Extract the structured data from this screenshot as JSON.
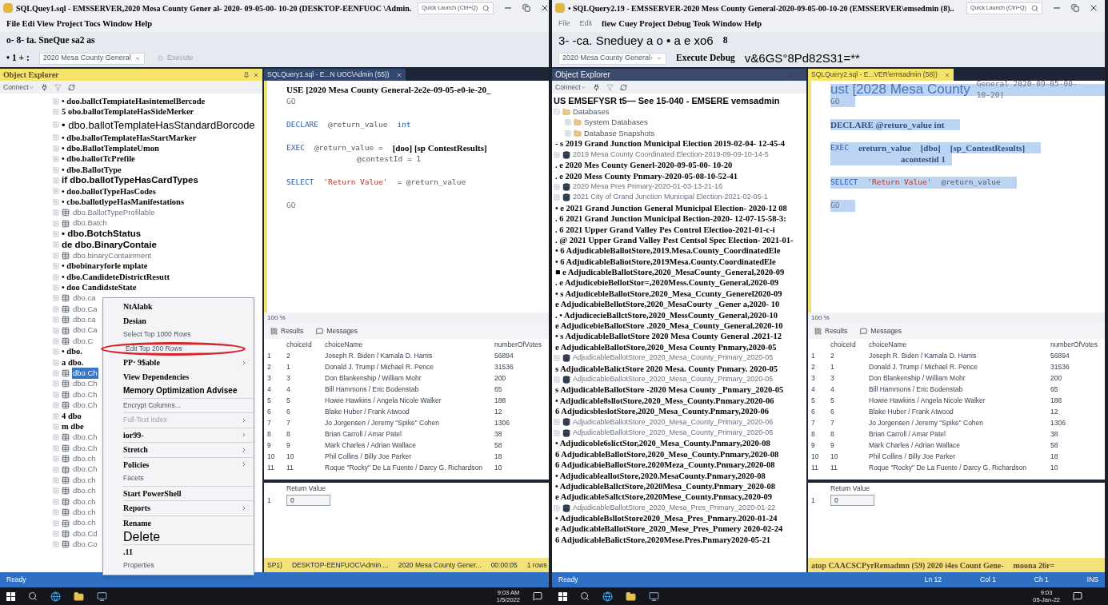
{
  "windows": [
    {
      "title": "SQLQuey1.sql - EMSSERVER,2020 Mesa County Gener al- 2020- 09-05-00- 10-20 (DESKTOP-EENFUOC \\Admin.",
      "quick_launch": {
        "placeholder": "Quick Launch (Ctrl+Q)"
      },
      "menu": [
        "File Edi View Project Tocs Window Help"
      ],
      "toolbar_1": [
        {
          "text": "o- 8- ta. SneQue sa2 as",
          "kind": "ocr"
        }
      ],
      "toolbar_2": [
        {
          "text": "• 1 + :",
          "kind": "ocr"
        },
        {
          "text": "2020 Mesa County General",
          "kind": "dropdown"
        },
        {
          "text": "Execute",
          "kind": "faint"
        }
      ],
      "explorer": {
        "title": "Object Explorer",
        "selected": true,
        "connect": "Connect",
        "items": [
          {
            "kind": "ocr",
            "text": "• doo.ballctTempiateHasintemelBercode",
            "selected": false
          },
          {
            "kind": "ocr",
            "text": "5 obo.ballotTemplateHasSideMerker",
            "selected": false
          },
          {
            "kind": "large",
            "text": "• dbo.ballotTemplateHasStandardBorcode",
            "selected": false
          },
          {
            "kind": "ocr",
            "text": "• dbo.ballotTemplateHasStartMarker",
            "selected": false
          },
          {
            "kind": "ocr",
            "text": "• dbo.BallotTemplateUmon",
            "selected": false
          },
          {
            "kind": "ocr",
            "text": "• dbo.ballotTcPrefile",
            "selected": false
          },
          {
            "kind": "ocr",
            "text": "• dbo.BallotType",
            "selected": false
          },
          {
            "kind": "sans",
            "text": "if dbo.ballotTypeHasCardTypes",
            "selected": false
          },
          {
            "kind": "ocr",
            "text": "• doo.ballotTypeHasCodes",
            "selected": false
          },
          {
            "kind": "ocr",
            "text": "• cbo.ballotlypeHasManifestations",
            "selected": false
          },
          {
            "kind": "table",
            "text": "dbo.BallotTypeProfilable",
            "selected": false
          },
          {
            "kind": "table",
            "text": "dbo.Batch",
            "selected": false
          },
          {
            "kind": "sans",
            "text": "• dbo.BotchStatus",
            "selected": false
          },
          {
            "kind": "sans",
            "text": "de dbo.BinaryContaie",
            "selected": false
          },
          {
            "kind": "table",
            "text": "dbo.binaryContainment",
            "selected": false
          },
          {
            "kind": "ocr",
            "text": "• dbobinaryforle mplate",
            "selected": false
          },
          {
            "kind": "ocr",
            "text": "• dbo.CandideteDistrictResutt",
            "selected": false
          },
          {
            "kind": "ocr",
            "text": "• doo CandidsteState",
            "selected": false
          },
          {
            "kind": "table",
            "text": "dbo.ca",
            "selected": false
          },
          {
            "kind": "table",
            "text": "dbo.Ca",
            "selected": false
          },
          {
            "kind": "table",
            "text": "dbo.ca",
            "selected": false
          },
          {
            "kind": "table",
            "text": "dbo.Ca",
            "selected": false
          },
          {
            "kind": "table",
            "text": "dbo.C",
            "selected": false
          },
          {
            "kind": "ocr",
            "text": "• dbo.",
            "selected": false
          },
          {
            "kind": "ocr",
            "text": "a dbo.",
            "selected": false
          },
          {
            "kind": "table",
            "text": "dbo Ch",
            "selected": true
          },
          {
            "kind": "table",
            "text": "dbo.Ch",
            "selected": false
          },
          {
            "kind": "table",
            "text": "dbo.Ch",
            "selected": false
          },
          {
            "kind": "table",
            "text": "dbo.Ch",
            "selected": false
          },
          {
            "kind": "ocr",
            "text": "4 dbo",
            "selected": false
          },
          {
            "kind": "ocr",
            "text": "m dbe",
            "selected": false
          },
          {
            "kind": "table",
            "text": "dbo.Ch",
            "selected": false
          },
          {
            "kind": "table",
            "text": "dbo.Ch",
            "selected": false
          },
          {
            "kind": "table",
            "text": "dbo.ch",
            "selected": false
          },
          {
            "kind": "table",
            "text": "dbo.Ch",
            "selected": false
          },
          {
            "kind": "table",
            "text": "dbo.ch",
            "selected": false
          },
          {
            "kind": "table",
            "text": "dbo.ch",
            "selected": false
          },
          {
            "kind": "table",
            "text": "dbo.ch",
            "selected": false
          },
          {
            "kind": "table",
            "text": "dbo.ch",
            "selected": false
          },
          {
            "kind": "table",
            "text": "dbo.ch",
            "selected": false
          },
          {
            "kind": "table",
            "text": "dbo.Cd",
            "selected": false
          },
          {
            "kind": "table",
            "text": "dbo.Co",
            "selected": false
          }
        ]
      },
      "query": {
        "tab": "SQLQuery1.sql - E...N UOC\\Admin (55))",
        "selected": false,
        "lines": [
          {
            "selected": false,
            "segments": [
              {
                "kind": "ocr",
                "text": "USE [2020 Mesa County General-2e2e-09-05-e0-ie-20_"
              }
            ]
          },
          {
            "selected": false,
            "segments": [
              {
                "kind": "plain",
                "text": "GO"
              }
            ]
          },
          {
            "selected": false
          },
          {
            "selected": false,
            "segments": [
              {
                "kind": "kw",
                "text": "DECLARE"
              },
              {
                "kind": "var",
                "text": "@return_value"
              },
              {
                "kind": "kw",
                "text": "int"
              }
            ]
          },
          {
            "selected": false
          },
          {
            "selected": false,
            "segments": [
              {
                "kind": "kw",
                "text": "EXEC"
              },
              {
                "kind": "var",
                "text": "@return_value ="
              },
              {
                "kind": "ocr",
                "text": "[doo] [sp ContestResults]"
              }
            ]
          },
          {
            "selected": false,
            "segments": [
              {
                "kind": "cont",
                "text": "@contestId = 1"
              }
            ]
          },
          {
            "selected": false
          },
          {
            "selected": false,
            "segments": [
              {
                "kind": "kw",
                "text": "SELECT"
              },
              {
                "kind": "str",
                "text": "'Return Value'"
              },
              {
                "kind": "var",
                "text": "= @return_value"
              }
            ]
          },
          {
            "selected": false
          },
          {
            "selected": false,
            "segments": [
              {
                "kind": "plain",
                "text": "GO"
              }
            ]
          }
        ],
        "zoom": "100 %",
        "results_tabs": [
          "Results",
          "Messages"
        ],
        "columns": [
          "",
          "choiceId",
          "choiceName",
          "numberOfVotes"
        ],
        "rows": [
          [
            "1",
            "2",
            "Joseph R. Biden / Kamala D. Harris",
            "56894"
          ],
          [
            "2",
            "1",
            "Donald J. Trump / Michael R. Pence",
            "31536"
          ],
          [
            "3",
            "3",
            "Don Blankenship / William Mohr",
            "200"
          ],
          [
            "4",
            "4",
            "Bill Hammons / Eric Bodenstab",
            "65"
          ],
          [
            "5",
            "5",
            "Howie Hawkins / Angela Nicole Walker",
            "188"
          ],
          [
            "6",
            "6",
            "Blake Huber / Frank Atwood",
            "12"
          ],
          [
            "7",
            "7",
            "Jo Jorgensen / Jeremy \"Spike\" Cohen",
            "1306"
          ],
          [
            "8",
            "8",
            "Brian Carroll / Amar Patel",
            "38"
          ],
          [
            "9",
            "9",
            "Mark Charles / Adrian Wallace",
            "58"
          ],
          [
            "10",
            "10",
            "Phil Collins / Billy Joe Parker",
            "18"
          ],
          [
            "11",
            "11",
            "Roque \"Rocky\" De La Fuente / Darcy G. Richardson",
            "10"
          ]
        ],
        "return_column": "Return Value",
        "return_rows": [
          [
            "1",
            "0"
          ]
        ],
        "query_status": [
          "SP1)",
          "DESKTOP-EENFUOC\\Admin ...",
          "2020 Mesa County Gener...",
          "00:00:05",
          "1 rows"
        ]
      },
      "status_bar": [
        "Ready"
      ],
      "context_menu": [
        {
          "text": "NtAlabk",
          "kind": "bold",
          "submenu": false,
          "separator_before": false,
          "circled": false
        },
        {
          "text": "Desian",
          "kind": "bold",
          "submenu": false,
          "separator_before": false,
          "circled": false
        },
        {
          "text": "Select Top 1000 Rows",
          "kind": "faint",
          "submenu": false,
          "separator_before": false,
          "circled": false
        },
        {
          "text": "Edit Top 200 Rows",
          "kind": "faint",
          "submenu": false,
          "separator_before": false,
          "circled": true
        },
        {
          "text": "PP· 9$able",
          "kind": "bold",
          "submenu": true,
          "separator_before": false,
          "circled": false
        },
        {
          "text": "View Dependencies",
          "kind": "bold",
          "submenu": false,
          "separator_before": false,
          "circled": false
        },
        {
          "text": "Memory Optimization Advisee",
          "kind": "sans",
          "submenu": false,
          "separator_before": false,
          "circled": false
        },
        {
          "text": "Encrypt Columns...",
          "kind": "faint",
          "submenu": false,
          "separator_before": true,
          "circled": false
        },
        {
          "text": "Full-Text index",
          "kind": "disabled",
          "submenu": true,
          "separator_before": true,
          "circled": false
        },
        {
          "text": "ior99-",
          "kind": "bold",
          "submenu": true,
          "separator_before": true,
          "circled": false
        },
        {
          "text": "Stretch",
          "kind": "bold",
          "submenu": true,
          "separator_before": true,
          "circled": false
        },
        {
          "text": "Policies",
          "kind": "bold",
          "submenu": true,
          "separator_before": true,
          "circled": false
        },
        {
          "text": "Facets",
          "kind": "faint",
          "submenu": false,
          "separator_before": false,
          "circled": false
        },
        {
          "text": "Start PowerShell",
          "kind": "bold",
          "submenu": false,
          "separator_before": true,
          "circled": false
        },
        {
          "text": "Reports",
          "kind": "bold",
          "submenu": true,
          "separator_before": true,
          "circled": false
        },
        {
          "text": "Rename",
          "kind": "bold",
          "submenu": false,
          "separator_before": true,
          "circled": false
        },
        {
          "text": "Delete",
          "kind": "large",
          "submenu": false,
          "separator_before": false,
          "circled": false
        },
        {
          "text": ".11",
          "kind": "bold",
          "submenu": false,
          "separator_before": true,
          "circled": false
        },
        {
          "text": "Properties",
          "kind": "faint",
          "submenu": false,
          "separator_before": false,
          "circled": false
        }
      ],
      "taskbar": {
        "time": "9:03 AM",
        "date": "1/5/2022"
      }
    },
    {
      "title": "• SQLQuery2.19 - EMSSERVER-2020 Mess County General-2020-09-05-00-10-20 (EMSSERVER\\emsedmin (8)..",
      "quick_launch": {
        "placeholder": "Quick Launch (Ctrl+Q)"
      },
      "menu": [
        "File",
        "Edit",
        "fiew Cuey Project Debug Teok Window Help"
      ],
      "toolbar_1": [
        {
          "text": "3- -ca. Sneduey a o • a e xo6",
          "kind": "large"
        },
        {
          "text": "8",
          "kind": "ocr"
        }
      ],
      "toolbar_2": [
        {
          "text": "2020 Mesa County General-",
          "kind": "dropdown"
        },
        {
          "text": "Execute Debug",
          "kind": "ocr"
        },
        {
          "text": "v&6GS°8Pd82S31=**",
          "kind": "large"
        }
      ],
      "explorer": {
        "title": "Object Explorer",
        "selected": false,
        "connect": "Connect",
        "items": [
          {
            "kind": "server",
            "text": "US EMSEFYSR t5— See 15-040 - EMSERE vemsadmin",
            "selected": false
          },
          {
            "kind": "folder",
            "text": "Databases",
            "selected": false,
            "expanded": true,
            "children": [
              {
                "kind": "folder",
                "text": "System Databases",
                "selected": false,
                "expanded": false
              },
              {
                "kind": "folder",
                "text": "Database Snapshots",
                "selected": false,
                "expanded": false
              }
            ]
          },
          {
            "kind": "ocr",
            "text": "- s 2019 Grand Junction Municipal Election 2019-02-04- 12-45-4",
            "selected": false
          },
          {
            "kind": "database",
            "text": "2019 Mesa County Coordinated Election-2019-09-09-10-14-5",
            "selected": false
          },
          {
            "kind": "ocr",
            "text": ". e 2020 Mes County Generl-2020-09-05-00- 10-20",
            "selected": false
          },
          {
            "kind": "ocr",
            "text": ". e 2020 Mess County Pnmary-2020-05-08-10-52-41",
            "selected": false
          },
          {
            "kind": "database",
            "text": "2020 Mesa Pres Primary-2020-01-03-13-21-16",
            "selected": false
          },
          {
            "kind": "database",
            "text": "2021 City of Grand Junction Municipal Election-2021-02-05-1",
            "selected": false
          },
          {
            "kind": "ocr",
            "text": "• e 2021 Grand Junction General Municipal Election- 2020-12 08",
            "selected": false
          },
          {
            "kind": "ocr",
            "text": ". 6 2021 Grand Junction Municipal Bection-2020- 12-07-15-58-3:",
            "selected": false
          },
          {
            "kind": "ocr",
            "text": ". 6 2021 Upper Grand Valley Pes Control Electioo-2021-01-c-i",
            "selected": false
          },
          {
            "kind": "ocr",
            "text": ". @ 2021 Upper Grand Valley Pest Centsol Spec Election- 2021-01-",
            "selected": false
          },
          {
            "kind": "ocr",
            "text": "• 6 AdjudicableBallotStore,2019.Mesa.County_CoordinatedEle",
            "selected": false
          },
          {
            "kind": "ocr",
            "text": "• 6 AdjudicableBaliotStore,2019Mesa.County.CoordinatedEle",
            "selected": false
          },
          {
            "kind": "ocr",
            "text": "■ e AdjudicableBallotStore,2020_MesaCounty_General,2020-09",
            "selected": false
          },
          {
            "kind": "ocr",
            "text": ". e AdjudicebieBellotStor=,2020Mess.County_General,2020-09",
            "selected": false
          },
          {
            "kind": "ocr",
            "text": "• s AdjudicebleBallotStore,2020_Mesa_Ccunty_Generel2020-09",
            "selected": false
          },
          {
            "kind": "ocr",
            "text": "e AdjudicabieBellotStore,2020_MesaCourty _Gener a,2020- 10",
            "selected": false
          },
          {
            "kind": "ocr",
            "text": ". • AdjudicecieBallctStore,2020_MessCounty_General,2020-10",
            "selected": false
          },
          {
            "kind": "ocr",
            "text": "e AdjudicebieBallotStore .2020_Mesa_County_General,2020-10",
            "selected": false
          },
          {
            "kind": "ocr",
            "text": "• s AdjudicableBallotStore 2020 Mesa County General .2021-12",
            "selected": false
          },
          {
            "kind": "ocr",
            "text": "e AdjudicableBallotStore,2020_Mesa County Pnmary,2020-05",
            "selected": false
          },
          {
            "kind": "database",
            "text": "AdjudicableBallotStore_2020_Mesa_County_Primary_2020-05",
            "selected": false
          },
          {
            "kind": "ocr",
            "text": "s AdjudicableBalictStore 2020 Mesa. County Pnmary. 2020-05",
            "selected": false
          },
          {
            "kind": "database",
            "text": "AdjudicableBallotStore_2020_Mesa_County_Primary_2020-05",
            "selected": false
          },
          {
            "kind": "ocr",
            "text": "s AdjudicableBallotStore -2020 Mesa County _Pnmary_2020-05",
            "selected": false
          },
          {
            "kind": "ocr",
            "text": "• Adjudicable8sllotStore,2020_Mess_County.Pnmary.2020-06",
            "selected": false
          },
          {
            "kind": "ocr",
            "text": "6 AdjudicsbleslotStore,2020_Mesa_County.Pnmary,2020-06",
            "selected": false
          },
          {
            "kind": "database",
            "text": "AdjudicableBallotStore_2020_Mesa_County_Primary_2020-06",
            "selected": false
          },
          {
            "kind": "database",
            "text": "AdjudicableBallotStore_2020_Mesa_County_Primary_2020-06",
            "selected": false
          },
          {
            "kind": "ocr",
            "text": "• Adjudicoble6slictStor,2020_Mesa_County.Pnmary,2020-08",
            "selected": false
          },
          {
            "kind": "ocr",
            "text": "6 AdjudicableBallotStore,2020_Meso_County.Pnmary,2020-08",
            "selected": false
          },
          {
            "kind": "ocr",
            "text": "6 AdjudicabieBallotStore,2020Meza_County.Pnmary,2020-08",
            "selected": false
          },
          {
            "kind": "ocr",
            "text": "• AdjudicableallotStore,2020.MesaCounty.Pnmary,2020-08",
            "selected": false
          },
          {
            "kind": "ocr",
            "text": "• AdjudicableBallctStore,2020Mesa_County.Pnmary_2020-08",
            "selected": false
          },
          {
            "kind": "ocr",
            "text": "e AdjudicableSallctStore,2020Mese_County.Pnmacy,2020-09",
            "selected": false
          },
          {
            "kind": "database",
            "text": "AdjudicableBallotStore_2020_Mesa_Pres_Primary_2020-01-22",
            "selected": false
          },
          {
            "kind": "ocr",
            "text": "• AdjudicableBsllotStore2020_Mesa_Pres_Pnmary.2020-01-24",
            "selected": false
          },
          {
            "kind": "ocr",
            "text": "e AdjudicableBallotStore_2020_Mese_Pres_Pnmery 2020-02-24",
            "selected": false
          },
          {
            "kind": "ocr",
            "text": "6 AdjudicableBalictStore,2020Mese.Pres.Pnmary2020-05-21",
            "selected": false
          }
        ]
      },
      "query": {
        "tab": "SQLQuery2.sql - E...VER\\emsadmin (58))",
        "selected": true,
        "lines": [
          {
            "selected": true,
            "segments": [
              {
                "kind": "big",
                "text": "ust [2028 Mesa County"
              },
              {
                "kind": "plain",
                "text": "General 2020-09-05-00-10-20]"
              }
            ]
          },
          {
            "selected": true,
            "segments": [
              {
                "kind": "plain",
                "text": "GO"
              }
            ]
          },
          {
            "selected": false
          },
          {
            "selected": true,
            "segments": [
              {
                "kind": "ocrblue",
                "text": "DECLARE @returo_value int"
              }
            ]
          },
          {
            "selected": false
          },
          {
            "selected": true,
            "segments": [
              {
                "kind": "kw",
                "text": "EXEC"
              },
              {
                "kind": "ocrblue",
                "text": "ereturn_value"
              },
              {
                "kind": "ocrblue",
                "text": "[dbo]"
              },
              {
                "kind": "ocrblue",
                "text": "[sp_ContestResults]"
              }
            ]
          },
          {
            "selected": true,
            "segments": [
              {
                "kind": "contblue",
                "text": "acontestid 1"
              }
            ]
          },
          {
            "selected": false
          },
          {
            "selected": true,
            "segments": [
              {
                "kind": "kw",
                "text": "SELECT"
              },
              {
                "kind": "str",
                "text": "'Return Value'"
              },
              {
                "kind": "var",
                "text": "@return_value"
              }
            ]
          },
          {
            "selected": false
          },
          {
            "selected": true,
            "segments": [
              {
                "kind": "plain",
                "text": "GO"
              }
            ]
          }
        ],
        "zoom": "100 %",
        "results_tabs": [
          "Results",
          "Messages"
        ],
        "columns": [
          "",
          "choiceId",
          "choiceName",
          "numberOfVotes"
        ],
        "rows": [
          [
            "1",
            "2",
            "Joseph R. Biden / Kamala D. Harris",
            "56894"
          ],
          [
            "2",
            "1",
            "Donald J. Trump / Michael R. Pence",
            "31536"
          ],
          [
            "3",
            "3",
            "Don Blankenship / William Mohr",
            "200"
          ],
          [
            "4",
            "4",
            "Bill Hammons / Eric Bodenstab",
            "65"
          ],
          [
            "5",
            "5",
            "Howie Hawkins / Angela Nicole Walker",
            "188"
          ],
          [
            "6",
            "6",
            "Blake Huber / Frank Atwood",
            "12"
          ],
          [
            "7",
            "7",
            "Jo Jorgensen / Jeremy \"Spike\" Cohen",
            "1306"
          ],
          [
            "8",
            "8",
            "Brian Carroll / Amar Patel",
            "38"
          ],
          [
            "9",
            "9",
            "Mark Charles / Adrian Wallace",
            "58"
          ],
          [
            "10",
            "10",
            "Phil Collins / Billy Joe Parker",
            "18"
          ],
          [
            "11",
            "11",
            "Roque \"Rocky\" De La Fuente / Darcy G. Richardson",
            "10"
          ]
        ],
        "return_column": "Return Value",
        "return_rows": [
          [
            "1",
            "0"
          ]
        ],
        "query_status": [
          "atop CAACSCPyrRemadmn (59) 2020 i4es Count Gene-",
          "moona 26r="
        ]
      },
      "status_bar": [
        "Ready",
        "Ln 12",
        "Col 1",
        "Ch 1",
        "INS"
      ],
      "taskbar": {
        "time": "9:03",
        "date": "05-Jan-22"
      }
    }
  ]
}
